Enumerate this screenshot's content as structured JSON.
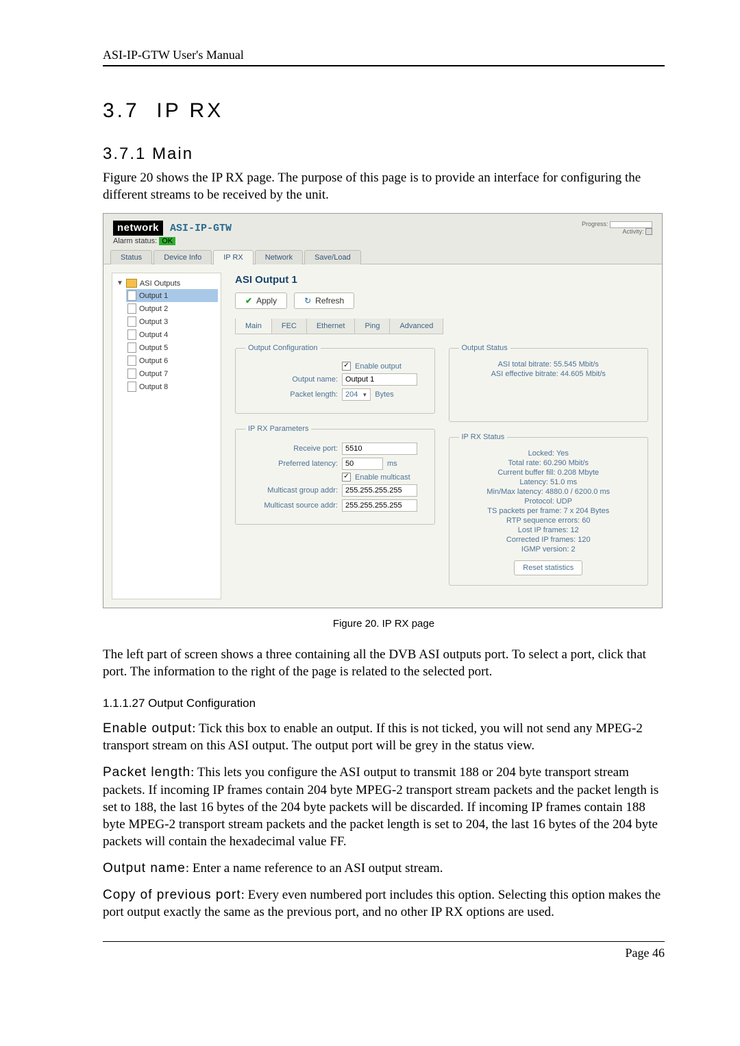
{
  "doc": {
    "header": "ASI-IP-GTW User's Manual",
    "section_num": "3.7",
    "section_title": "IP RX",
    "subsection_num": "3.7.1",
    "subsection_title": "Main",
    "intro": "Figure 20 shows the IP RX page. The purpose of this page is to provide an interface for configuring the different streams to be received by the unit.",
    "fig_caption": "Figure 20. IP RX page",
    "para_after": "The left part of screen shows a three containing all the DVB ASI outputs port. To select a port, click that port. The information to the right of the page is related to the selected port.",
    "subsub": "1.1.1.27 Output Configuration",
    "enable_term": "Enable output",
    "enable_text": ": Tick this box to enable an output. If this is not ticked, you will not send any MPEG-2 transport stream on this ASI output. The output port will be grey in the status view.",
    "packet_term": "Packet length",
    "packet_text": ": This lets you configure the ASI output to transmit 188 or 204 byte transport stream packets. If incoming IP frames contain 204 byte MPEG-2 transport stream packets and the packet length is set to 188, the last 16 bytes of the 204 byte packets will be discarded. If incoming IP frames contain 188 byte MPEG-2 transport stream packets and the packet length is set to 204, the last 16 bytes of the 204 byte packets will contain the hexadecimal value FF.",
    "outname_term": "Output name",
    "outname_text": ": Enter a name reference to an ASI output stream.",
    "copy_term": "Copy of previous port",
    "copy_text": ": Every even numbered port includes this option. Selecting this option makes the port output exactly the same as the previous port, and no other IP RX options are used.",
    "footer": "Page 46"
  },
  "app": {
    "brand": "network",
    "model": "ASI-IP-GTW",
    "progress_label": "Progress:",
    "activity_label": "Activity:",
    "alarm_label": "Alarm status:",
    "alarm_value": "OK",
    "tabs": [
      "Status",
      "Device Info",
      "IP RX",
      "Network",
      "Save/Load"
    ],
    "tree_root": "ASI Outputs",
    "tree_items": [
      "Output 1",
      "Output 2",
      "Output 3",
      "Output 4",
      "Output 5",
      "Output 6",
      "Output 7",
      "Output 8"
    ],
    "title": "ASI Output 1",
    "apply": "Apply",
    "refresh": "Refresh",
    "inner_tabs": [
      "Main",
      "FEC",
      "Ethernet",
      "Ping",
      "Advanced"
    ],
    "oc_legend": "Output Configuration",
    "enable_output": "Enable output",
    "output_name_label": "Output name:",
    "output_name_value": "Output 1",
    "packet_length_label": "Packet length:",
    "packet_length_value": "204",
    "packet_length_unit": "Bytes",
    "os_legend": "Output Status",
    "os_line1": "ASI total bitrate: 55.545 Mbit/s",
    "os_line2": "ASI effective bitrate: 44.605 Mbit/s",
    "iprx_legend": "IP RX Parameters",
    "recv_port_label": "Receive port:",
    "recv_port_value": "5510",
    "pref_lat_label": "Preferred latency:",
    "pref_lat_value": "50",
    "pref_lat_unit": "ms",
    "enable_multicast": "Enable multicast",
    "mgrp_label": "Multicast group addr:",
    "mgrp_value": "255.255.255.255",
    "msrc_label": "Multicast source addr:",
    "msrc_value": "255.255.255.255",
    "iprxs_legend": "IP RX Status",
    "iprxs": [
      "Locked: Yes",
      "Total rate: 60.290 Mbit/s",
      "Current buffer fill: 0.208 Mbyte",
      "Latency: 51.0 ms",
      "Min/Max latency: 4880.0 / 6200.0 ms",
      "Protocol: UDP",
      "TS packets per frame: 7 x 204 Bytes",
      "RTP sequence errors: 60",
      "Lost IP frames: 12",
      "Corrected IP frames: 120",
      "IGMP version: 2"
    ],
    "reset_stats": "Reset statistics"
  }
}
